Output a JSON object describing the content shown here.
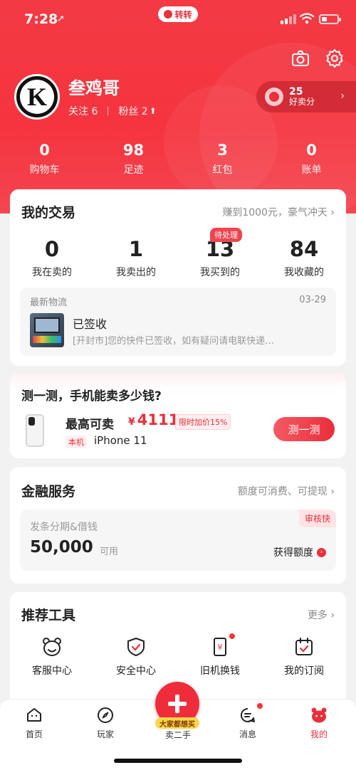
{
  "status_bar": {
    "time": "7:28",
    "location_arrow": "➚",
    "app_pill": "转转"
  },
  "profile": {
    "username": "叁鸡哥",
    "avatar_letter": "K",
    "follow_label": "关注 6",
    "fans_label": "粉丝 2",
    "score_value": "25",
    "score_label": "好卖分"
  },
  "stats": [
    {
      "value": "0",
      "label": "购物车"
    },
    {
      "value": "98",
      "label": "足迹"
    },
    {
      "value": "3",
      "label": "红包"
    },
    {
      "value": "0",
      "label": "账单"
    }
  ],
  "trade": {
    "title": "我的交易",
    "right_link": "赚到1000元，豪气冲天 ›",
    "pending_badge": "待处理",
    "items": [
      {
        "value": "0",
        "label": "我在卖的"
      },
      {
        "value": "1",
        "label": "我卖出的"
      },
      {
        "value": "13",
        "label": "我买到的"
      },
      {
        "value": "84",
        "label": "我收藏的"
      }
    ],
    "logistics": {
      "head": "最新物流",
      "date": "03-29",
      "status": "已签收",
      "desc": "[开封市]您的快件已签收，如有疑问请电联快递…"
    }
  },
  "test": {
    "title": "测一测，手机能卖多少钱?",
    "highest_label": "最高可卖",
    "currency": "¥",
    "price": "4111",
    "promo": "限时加价15%",
    "device_tag": "本机",
    "model": "iPhone 11",
    "button": "测一测"
  },
  "finance": {
    "title": "金融服务",
    "right_link": "额度可消费、可提现 ›",
    "subtitle": "发条分期&借钱",
    "amount": "50,000",
    "available": "可用",
    "quick_tag": "审核快",
    "get_label": "获得额度"
  },
  "tools": {
    "title": "推荐工具",
    "more": "更多 ›",
    "items": [
      {
        "label": "客服中心",
        "icon": "customer-service-icon"
      },
      {
        "label": "安全中心",
        "icon": "shield-icon"
      },
      {
        "label": "旧机换钱",
        "icon": "trade-in-icon"
      },
      {
        "label": "我的订阅",
        "icon": "calendar-icon"
      }
    ]
  },
  "tabbar": {
    "tabs": [
      {
        "label": "首页",
        "icon": "home-icon"
      },
      {
        "label": "玩家",
        "icon": "compass-icon"
      },
      {
        "label": "卖二手",
        "icon": "plus-icon"
      },
      {
        "label": "消息",
        "icon": "message-icon"
      },
      {
        "label": "我的",
        "icon": "profile-bear-icon"
      }
    ],
    "sell_badge": "大家都想买"
  },
  "colors": {
    "brand_red": "#f33a44",
    "accent_red": "#e8303c",
    "badge_yellow": "#ffd54a"
  }
}
